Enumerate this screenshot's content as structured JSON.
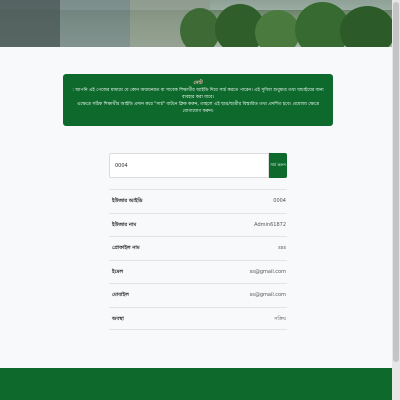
{
  "notice": {
    "title": "নোট",
    "line1": ": আপনি এই পেজের মাধ্যমে যে কোন অধ্যয়নরত বা সাবেক শিক্ষার্থীর আইডি দিয়ে সার্চ করতে পারেন। এই সুবিধা শুধুমাত্র তথ্য যাচাইয়ের জন্য ব্যবহার করা যাবে।",
    "line2": "এক্ষেত্রে সঠিক শিক্ষার্থীর আইডি প্রদান করে \"সার্চ\" বাটনে ক্লিক করুন, তাহলে এই ছাত্র/ছাত্রীর বিস্তারিত তথ্য প্রদর্শিত হবে। প্রযোজ্য ক্ষেত্রে যোগাযোগ করুন।"
  },
  "search": {
    "value": "0004",
    "button_label": "সার্চ করুন"
  },
  "info_rows": [
    {
      "label": "ইউজার আইডি",
      "value": "0004"
    },
    {
      "label": "ইউজার নাম",
      "value": "Admin61872"
    },
    {
      "label": "প্রোফাইল নাম",
      "value": "sss"
    },
    {
      "label": "ইমেল",
      "value": "ss@gmail.com"
    },
    {
      "label": "মোবাইল",
      "value": "ss@gmail.com"
    },
    {
      "label": "অবস্থা",
      "value": "সক্রিয়"
    }
  ],
  "colors": {
    "brand_green": "#0d6a2c",
    "notice_title": "#ffb3b3"
  }
}
